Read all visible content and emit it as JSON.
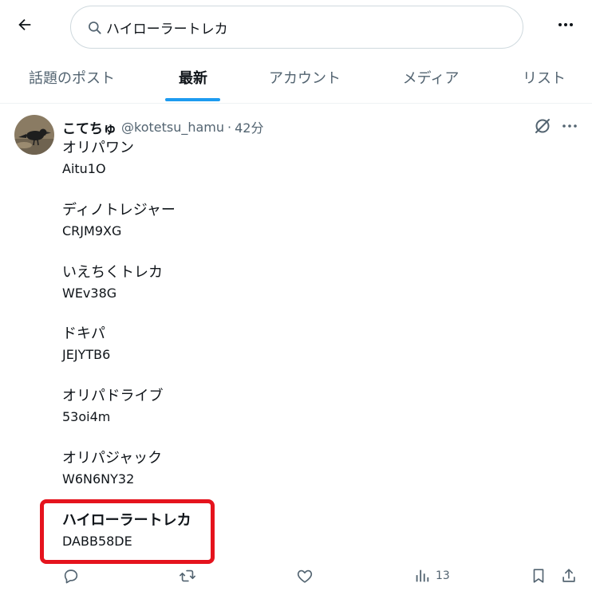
{
  "search": {
    "query": "ハイローラートレカ"
  },
  "tabs": [
    {
      "label": "話題のポスト"
    },
    {
      "label": "最新"
    },
    {
      "label": "アカウント"
    },
    {
      "label": "メディア"
    },
    {
      "label": "リスト"
    }
  ],
  "tweet": {
    "display_name": "こてちゅ",
    "handle": "@kotetsu_hamu",
    "separator": "·",
    "time": "42分",
    "entries": [
      {
        "name": "オリパワン",
        "code": "Aitu1O"
      },
      {
        "name": "ディノトレジャー",
        "code": "CRJM9XG"
      },
      {
        "name": "いえちくトレカ",
        "code": "WEv38G"
      },
      {
        "name": "ドキパ",
        "code": "JEJYTB6"
      },
      {
        "name": "オリパドライブ",
        "code": "53oi4m"
      },
      {
        "name": "オリパジャック",
        "code": "W6N6NY32"
      },
      {
        "name": "ハイローラートレカ",
        "code": "DABB58DE"
      }
    ],
    "highlighted_index": 6,
    "views_count": "13"
  },
  "colors": {
    "accent": "#1d9bf0",
    "highlight_border": "#e5131d",
    "secondary_text": "#536471",
    "primary_text": "#0f1419"
  },
  "icons": [
    "back-arrow-icon",
    "search-icon",
    "more-icon",
    "grok-icon",
    "reply-icon",
    "repost-icon",
    "like-icon",
    "views-icon",
    "bookmark-icon",
    "share-icon"
  ]
}
